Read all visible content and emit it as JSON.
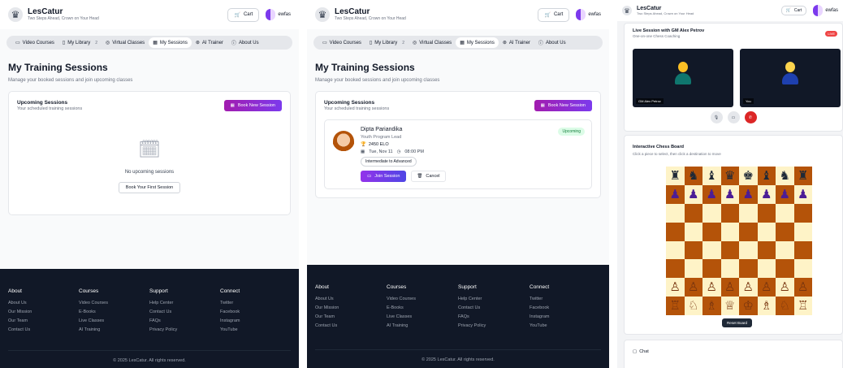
{
  "brand": {
    "name": "LesCatur",
    "tagline": "Two Steps Ahead, Crown on Your Head"
  },
  "header": {
    "cart_label": "Cart",
    "username": "ewfas"
  },
  "nav": {
    "items": [
      {
        "label": "Video Courses",
        "icon": "video-icon"
      },
      {
        "label": "My Library",
        "icon": "book-icon",
        "badge": "2"
      },
      {
        "label": "Virtual Classes",
        "icon": "eye-icon"
      },
      {
        "label": "My Sessions",
        "icon": "calendar-icon",
        "active": true
      },
      {
        "label": "AI Trainer",
        "icon": "bot-icon"
      },
      {
        "label": "About Us",
        "icon": "info-icon"
      }
    ]
  },
  "page": {
    "title": "My Training Sessions",
    "subtitle": "Manage your booked sessions and join upcoming classes"
  },
  "upcoming": {
    "title": "Upcoming Sessions",
    "subtitle": "Your scheduled training sessions",
    "book_label": "Book New Session"
  },
  "empty_state": {
    "text": "No upcoming sessions",
    "button": "Book Your First Session"
  },
  "session": {
    "coach": "Dipta Pariandika",
    "role": "Youth Program Lead",
    "elo": "2450 ELO",
    "date": "Tue, Nov 11",
    "time": "08:00 PM",
    "level": "Intermediate to Advanced",
    "status": "Upcoming",
    "join_label": "Join Session",
    "cancel_label": "Cancel"
  },
  "footer": {
    "columns": [
      {
        "head": "About",
        "links": [
          "About Us",
          "Our Mission",
          "Our Team",
          "Contact Us"
        ]
      },
      {
        "head": "Courses",
        "links": [
          "Video Courses",
          "E-Books",
          "Live Classes",
          "AI Training"
        ]
      },
      {
        "head": "Support",
        "links": [
          "Help Center",
          "Contact Us",
          "FAQs",
          "Privacy Policy"
        ]
      },
      {
        "head": "Connect",
        "links": [
          "Twitter",
          "Facebook",
          "Instagram",
          "YouTube"
        ]
      }
    ],
    "copyright": "© 2025 LesCatur. All rights reserved."
  },
  "live": {
    "title": "Live Session with GM Alex Petrov",
    "subtitle": "One-on-one Chess Coaching",
    "badge": "LIVE",
    "video1_label": "GM Alex Petrov",
    "video2_label": "You",
    "controls": [
      "mic-icon",
      "video-off-icon",
      "end-call-icon"
    ]
  },
  "board": {
    "title": "Interactive Chess Board",
    "subtitle": "Click a piece to select, then click a destination to move",
    "reset_label": "Reset Board",
    "rows": [
      [
        "♜",
        "♞",
        "♝",
        "♛",
        "♚",
        "♝",
        "♞",
        "♜"
      ],
      [
        "♟",
        "♟",
        "♟",
        "♟",
        "♟",
        "♟",
        "♟",
        "♟"
      ],
      [
        "",
        "",
        "",
        "",
        "",
        "",
        "",
        ""
      ],
      [
        "",
        "",
        "",
        "",
        "",
        "",
        "",
        ""
      ],
      [
        "",
        "",
        "",
        "",
        "",
        "",
        "",
        ""
      ],
      [
        "",
        "",
        "",
        "",
        "",
        "",
        "",
        ""
      ],
      [
        "♙",
        "♙",
        "♙",
        "♙",
        "♙",
        "♙",
        "♙",
        "♙"
      ],
      [
        "♖",
        "♘",
        "♗",
        "♕",
        "♔",
        "♗",
        "♘",
        "♖"
      ]
    ]
  },
  "chat": {
    "title": "Chat"
  }
}
